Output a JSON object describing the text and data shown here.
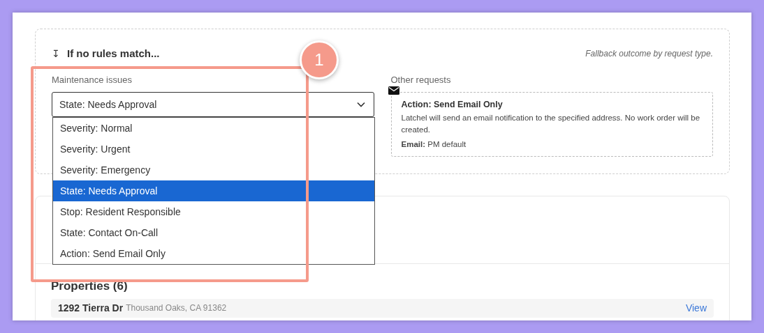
{
  "fallback": {
    "icon": "↧",
    "title": "If no rules match...",
    "note": "Fallback outcome by request type.",
    "maintenance": {
      "label": "Maintenance issues",
      "value": "State: Needs Approval",
      "expanded": true,
      "options": [
        {
          "label": "Severity: Normal",
          "selected": false
        },
        {
          "label": "Severity: Urgent",
          "selected": false
        },
        {
          "label": "Severity: Emergency",
          "selected": false
        },
        {
          "label": "State: Needs Approval",
          "selected": true
        },
        {
          "label": "Stop: Resident Responsible",
          "selected": false
        },
        {
          "label": "State: Contact On-Call",
          "selected": false
        },
        {
          "label": "Action: Send Email Only",
          "selected": false
        }
      ]
    },
    "other": {
      "label": "Other requests",
      "action": "Action: Send Email Only",
      "description": "Latchel will send an email notification to the specified address. No work order will be created.",
      "email_label": "Email:",
      "email_value": "PM default"
    }
  },
  "properties": {
    "title": "Properties (6)",
    "rows": [
      {
        "street": "1292 Tierra Dr",
        "city": "Thousand Oaks, CA 91362",
        "link": "View"
      }
    ]
  },
  "annotation": {
    "label": "1"
  }
}
